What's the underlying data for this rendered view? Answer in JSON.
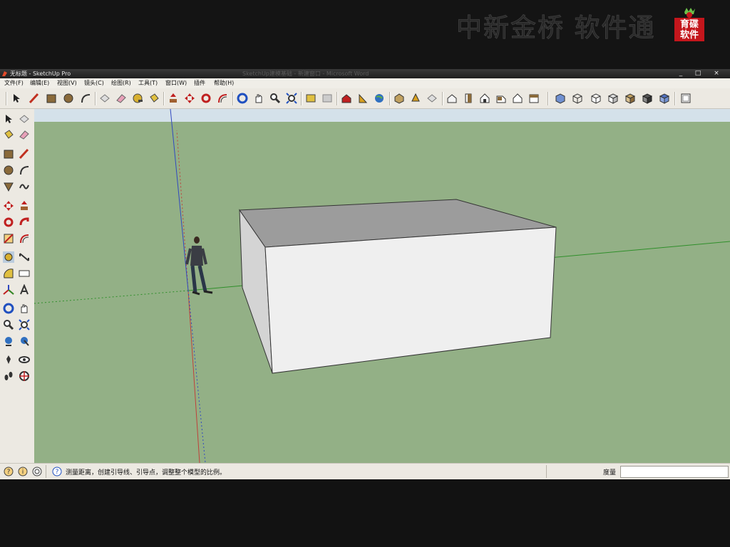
{
  "watermark": {
    "text": "中新金桥 软件通",
    "logo_text_1": "育碟",
    "logo_text_2": "软件"
  },
  "window": {
    "title": "无标题 - SketchUp Pro",
    "ghost_title": "SketchUp建模基础 - 新建窗口 - Microsoft Word",
    "minimize": "_",
    "maximize": "□",
    "close": "×"
  },
  "menu": {
    "items": [
      "文件(F)",
      "编辑(E)",
      "视图(V)",
      "镜头(C)",
      "绘图(R)",
      "工具(T)",
      "窗口(W)",
      "插件",
      "帮助(H)"
    ]
  },
  "toolbar": {
    "icons": [
      "select-icon",
      "line-icon",
      "rectangle-icon",
      "circle-icon",
      "arc-icon",
      "make-component-icon",
      "eraser-icon",
      "tape-measure-icon",
      "paint-bucket-icon",
      "push-pull-icon",
      "move-icon",
      "rotate-icon",
      "offset-icon",
      "orbit-icon",
      "pan-icon",
      "zoom-icon",
      "zoom-extents-icon",
      "previous-view-icon",
      "next-view-icon",
      "get-models-icon",
      "share-model-icon",
      "google-earth-icon",
      "component-icon",
      "materials-icon",
      "styles-icon",
      "iso-view-icon",
      "top-view-icon",
      "front-view-icon",
      "right-view-icon",
      "back-view-icon",
      "left-view-icon",
      "xray-icon",
      "wireframe-icon",
      "hidden-line-icon",
      "shaded-icon",
      "shaded-texture-icon",
      "monochrome-icon",
      "section-plane-icon"
    ]
  },
  "left_tools": {
    "icons": [
      "select-icon",
      "make-component-icon",
      "paint-bucket-icon",
      "eraser-icon",
      "rectangle-icon",
      "line-icon",
      "circle-icon",
      "arc-icon",
      "polygon-icon",
      "freehand-icon",
      "move-icon",
      "push-pull-icon",
      "rotate-icon",
      "follow-me-icon",
      "scale-icon",
      "offset-icon",
      "tape-measure-icon",
      "dimension-icon",
      "protractor-icon",
      "text-icon",
      "axes-icon",
      "3d-text-icon",
      "orbit-icon",
      "pan-icon",
      "zoom-icon",
      "zoom-window-icon",
      "zoom-extents-icon",
      "previous-icon",
      "position-camera-icon",
      "look-around-icon",
      "walk-icon",
      "section-plane-icon"
    ]
  },
  "status": {
    "hint_text": "测量距离，创建引导线、引导点，调整整个模型的比例。",
    "measure_label": "度量",
    "measure_value": ""
  },
  "colors": {
    "sky": "#d4e1ea",
    "ground": "#93b086",
    "box_top": "#9c9c9c",
    "box_front": "#efefef",
    "box_side": "#d4d4d4",
    "axis_red": "#c0403a",
    "axis_green": "#2f8f2a",
    "axis_blue": "#3048c0"
  }
}
